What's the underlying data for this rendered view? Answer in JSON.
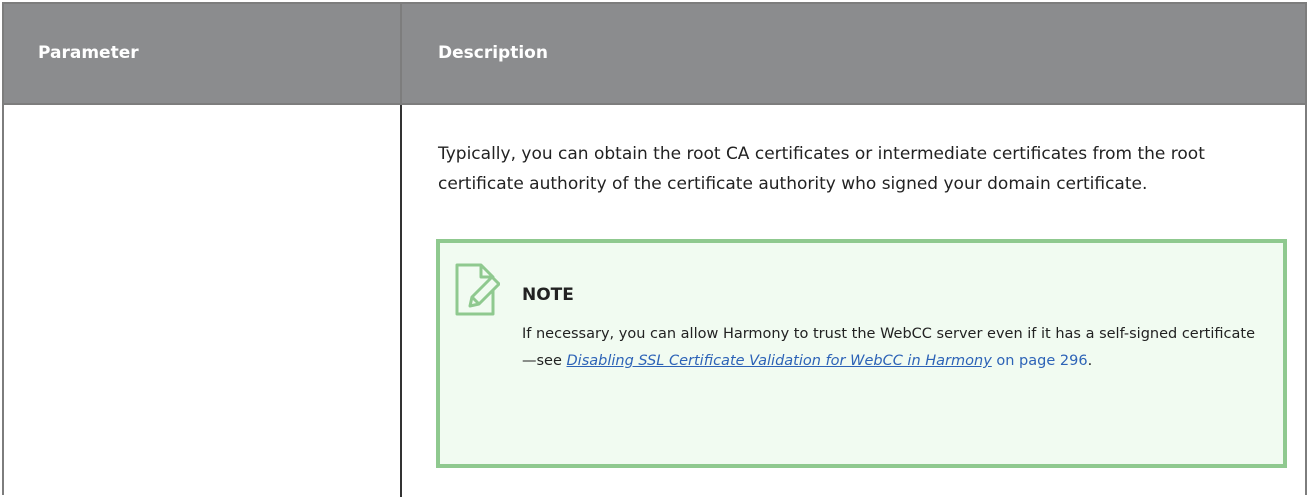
{
  "table": {
    "headers": {
      "parameter": "Parameter",
      "description": "Description"
    },
    "row": {
      "parameter": "",
      "description": "Typically, you can obtain the root CA certificates or intermediate certificates from the root certificate authority of the certificate authority who signed your domain certificate."
    }
  },
  "note": {
    "icon": "note-edit-icon",
    "title": "NOTE",
    "text_before": "If necessary, you can allow Harmony to trust the WebCC server even if it has a self-signed certificate—see ",
    "link_text": "Disabling SSL Certificate Validation for WebCC in Harmony",
    "page_ref": "on page 296",
    "text_after": ".",
    "colors": {
      "border": "#8fc98f",
      "background": "#f1fbf1",
      "icon": "#8fc98f",
      "link": "#2d63b7"
    }
  },
  "colors": {
    "header_background": "#8b8c8e",
    "header_text": "#ffffff",
    "border": "#7d7d7d"
  }
}
